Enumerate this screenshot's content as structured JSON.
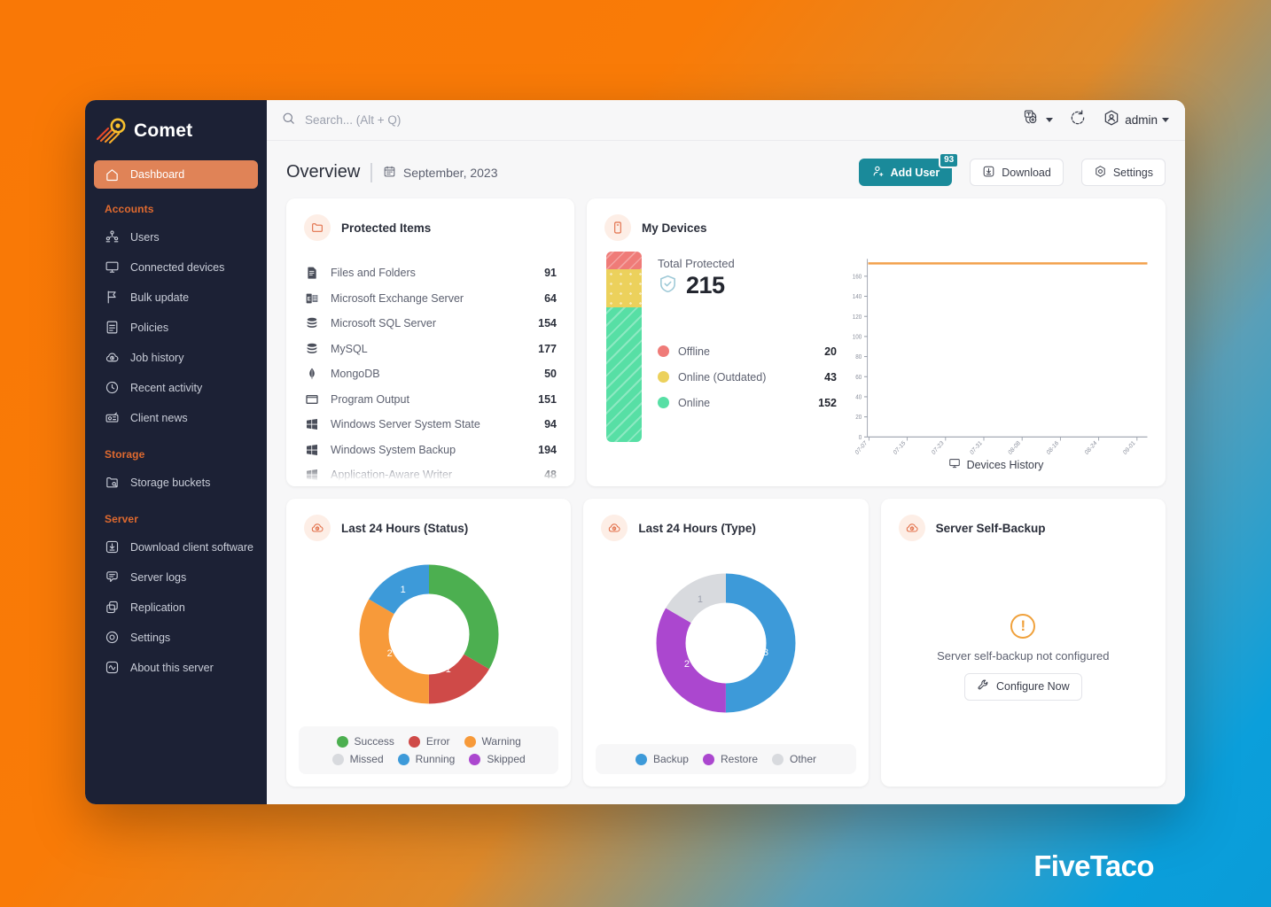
{
  "brand": {
    "name": "Comet"
  },
  "sidebar": {
    "top_items": [
      {
        "label": "Dashboard",
        "icon": "home-icon",
        "active": true
      }
    ],
    "groups": [
      {
        "title": "Accounts",
        "items": [
          {
            "label": "Users",
            "icon": "users-icon"
          },
          {
            "label": "Connected devices",
            "icon": "monitor-icon"
          },
          {
            "label": "Bulk update",
            "icon": "flag-icon"
          },
          {
            "label": "Policies",
            "icon": "document-icon"
          },
          {
            "label": "Job history",
            "icon": "cloud-clock-icon"
          },
          {
            "label": "Recent activity",
            "icon": "clock-icon"
          },
          {
            "label": "Client news",
            "icon": "radio-icon"
          }
        ]
      },
      {
        "title": "Storage",
        "items": [
          {
            "label": "Storage buckets",
            "icon": "bucket-icon"
          }
        ]
      },
      {
        "title": "Server",
        "items": [
          {
            "label": "Download client software",
            "icon": "download-box-icon"
          },
          {
            "label": "Server logs",
            "icon": "message-icon"
          },
          {
            "label": "Replication",
            "icon": "copy-icon"
          },
          {
            "label": "Settings",
            "icon": "gear-circle-icon"
          },
          {
            "label": "About this server",
            "icon": "pulse-icon"
          }
        ]
      }
    ]
  },
  "topbar": {
    "search_placeholder": "Search... (Alt + Q)",
    "language_icon": "language-switch-icon",
    "refresh_icon": "refresh-icon",
    "user_icon": "user-circle-icon",
    "user_label": "admin"
  },
  "page": {
    "title": "Overview",
    "date": "September, 2023",
    "calendar_icon": "calendar-icon",
    "actions": [
      {
        "label": "Add User",
        "icon": "add-user-icon",
        "badge": "93",
        "primary": true
      },
      {
        "label": "Download",
        "icon": "download-icon",
        "primary": false
      },
      {
        "label": "Settings",
        "icon": "settings-icon",
        "primary": false
      }
    ]
  },
  "protected_items": {
    "title": "Protected Items",
    "icon": "folder-icon",
    "rows": [
      {
        "label": "Files and Folders",
        "value": "91",
        "icon": "file-icon"
      },
      {
        "label": "Microsoft Exchange Server",
        "value": "64",
        "icon": "exchange-icon"
      },
      {
        "label": "Microsoft SQL Server",
        "value": "154",
        "icon": "database-icon"
      },
      {
        "label": "MySQL",
        "value": "177",
        "icon": "database-icon"
      },
      {
        "label": "MongoDB",
        "value": "50",
        "icon": "mongodb-icon"
      },
      {
        "label": "Program Output",
        "value": "151",
        "icon": "window-icon"
      },
      {
        "label": "Windows Server System State",
        "value": "94",
        "icon": "windows-icon"
      },
      {
        "label": "Windows System Backup",
        "value": "194",
        "icon": "windows-icon"
      },
      {
        "label": "Application-Aware Writer",
        "value": "48",
        "icon": "windows-icon"
      }
    ]
  },
  "my_devices": {
    "title": "My Devices",
    "icon": "device-icon",
    "total_label": "Total Protected",
    "total_value": "215",
    "shield_icon": "shield-check-icon",
    "legend": [
      {
        "label": "Offline",
        "value": "20",
        "color": "#ef7b78"
      },
      {
        "label": "Online (Outdated)",
        "value": "43",
        "color": "#ecd15c"
      },
      {
        "label": "Online",
        "value": "152",
        "color": "#57dfa5"
      }
    ],
    "chart_caption": "Devices History",
    "chart_caption_icon": "monitor-icon"
  },
  "last24_status": {
    "title": "Last 24 Hours (Status)",
    "icon": "cloud-clock-icon",
    "legend": [
      {
        "label": "Success",
        "color": "#4caf50"
      },
      {
        "label": "Error",
        "color": "#cf4a48"
      },
      {
        "label": "Warning",
        "color": "#f79a3a"
      },
      {
        "label": "Missed",
        "color": "#d8dade"
      },
      {
        "label": "Running",
        "color": "#3d9ad9"
      },
      {
        "label": "Skipped",
        "color": "#ab47cf"
      }
    ]
  },
  "last24_type": {
    "title": "Last 24 Hours (Type)",
    "icon": "cloud-clock-icon",
    "legend": [
      {
        "label": "Backup",
        "color": "#3d9ad9"
      },
      {
        "label": "Restore",
        "color": "#ab47cf"
      },
      {
        "label": "Other",
        "color": "#d8dade"
      }
    ]
  },
  "self_backup": {
    "title": "Server Self-Backup",
    "icon": "cloud-clock-icon",
    "warning_icon": "warning-icon",
    "message": "Server self-backup not configured",
    "button_label": "Configure Now",
    "button_icon": "wrench-icon"
  },
  "watermark": "FiveTaco",
  "chart_data": [
    {
      "type": "line",
      "title": "Devices History",
      "xlabel": "",
      "ylabel": "",
      "x": [
        "07-07",
        "07-15",
        "07-23",
        "07-31",
        "08-08",
        "08-16",
        "08-24",
        "09-01"
      ],
      "xticks": [
        "07-07",
        "07-15",
        "07-23",
        "07-31",
        "08-08",
        "08-16",
        "08-24",
        "09-01"
      ],
      "yticks": [
        0,
        20,
        40,
        60,
        80,
        100,
        120,
        140,
        160
      ],
      "ylim": [
        0,
        175
      ],
      "grid": false,
      "series": [
        {
          "name": "Devices",
          "color": "#f2a14c",
          "values": [
            172,
            172,
            172,
            172,
            172,
            172,
            172,
            172
          ]
        }
      ]
    },
    {
      "type": "pie",
      "title": "Last 24 Hours (Status)",
      "labels": [
        "Success",
        "Error",
        "Warning",
        "Missed",
        "Running",
        "Skipped"
      ],
      "values": [
        2,
        1,
        2,
        0,
        1,
        0
      ],
      "colors": [
        "#4caf50",
        "#cf4a48",
        "#f79a3a",
        "#d8dade",
        "#3d9ad9",
        "#ab47cf"
      ],
      "legend": "bottom",
      "donut": true
    },
    {
      "type": "pie",
      "title": "Last 24 Hours (Type)",
      "labels": [
        "Backup",
        "Restore",
        "Other"
      ],
      "values": [
        3,
        2,
        1
      ],
      "colors": [
        "#3d9ad9",
        "#ab47cf",
        "#d8dade"
      ],
      "legend": "bottom",
      "donut": true
    },
    {
      "type": "bar",
      "title": "Total Protected devices gauge",
      "categories": [
        "Offline",
        "Online (Outdated)",
        "Online"
      ],
      "values": [
        20,
        43,
        152
      ],
      "colors": [
        "#ef7b78",
        "#ecd15c",
        "#57dfa5"
      ],
      "total": 215
    }
  ]
}
